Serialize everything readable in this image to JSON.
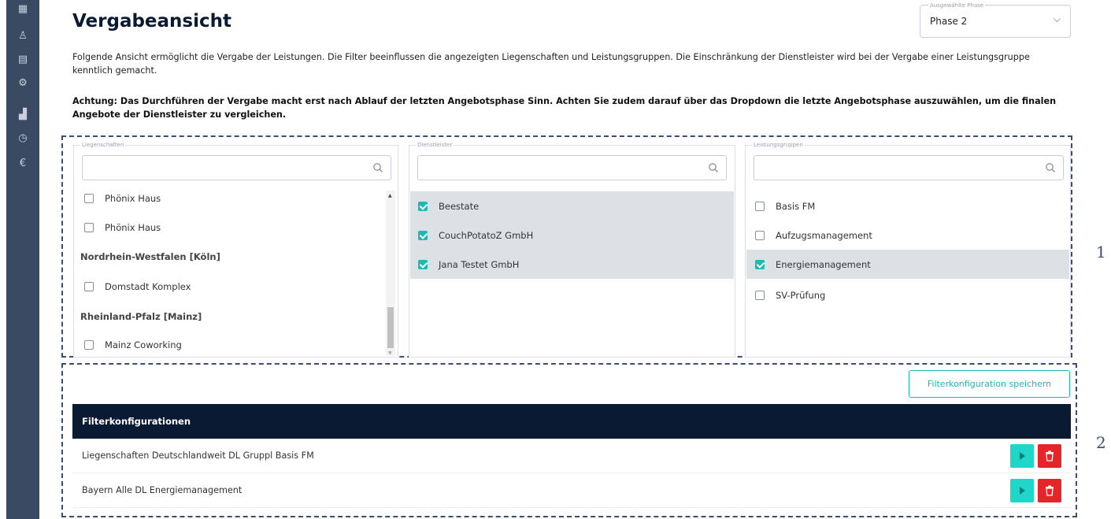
{
  "page_title": "Vergabeansicht",
  "phase_select": {
    "label": "Ausgewählte Phase",
    "value": "Phase 2"
  },
  "description": "Folgende Ansicht ermöglicht die Vergabe der Leistungen. Die Filter beeinflussen die angezeigten Liegenschaften und Leistungsgruppen. Die Einschränkung der Dienstleister wird bei der Vergabe einer Leistungsgruppe kenntlich gemacht.",
  "warning": "Achtung: Das Durchführen der Vergabe macht erst nach Ablauf der letzten Angebotsphase Sinn. Achten Sie zudem darauf über das Dropdown die letzte Angebotsphase auszuwählen, um die finalen Angebote der Dienstleister zu vergleichen.",
  "liegenschaften": {
    "label": "Liegenschaften",
    "items": [
      {
        "type": "item",
        "label": "Phönix Haus",
        "checked": false
      },
      {
        "type": "item",
        "label": "Phönix Haus",
        "checked": false
      },
      {
        "type": "group",
        "label": "Nordrhein-Westfalen [Köln]"
      },
      {
        "type": "item",
        "label": "Domstadt Komplex",
        "checked": false
      },
      {
        "type": "group",
        "label": "Rheinland-Pfalz [Mainz]"
      },
      {
        "type": "item",
        "label": "Mainz Coworking",
        "checked": false
      }
    ]
  },
  "dienstleister": {
    "label": "Dienstleister",
    "items": [
      {
        "label": "Beestate",
        "checked": true
      },
      {
        "label": "CouchPotatoZ GmbH",
        "checked": true
      },
      {
        "label": "Jana Testet GmbH",
        "checked": true
      }
    ]
  },
  "leistungsgruppen": {
    "label": "Leistungsgruppen",
    "items": [
      {
        "label": "Basis FM",
        "checked": false
      },
      {
        "label": "Aufzugsmanagement",
        "checked": false
      },
      {
        "label": "Energiemanagement",
        "checked": true
      },
      {
        "label": "SV-Prüfung",
        "checked": false
      }
    ]
  },
  "save_button": "Filterkonfiguration speichern",
  "table": {
    "header": "Filterkonfigurationen",
    "rows": [
      {
        "name": "Liegenschaften Deutschlandweit DL Gruppl Basis FM"
      },
      {
        "name": "Bayern Alle DL Energiemanagement"
      }
    ]
  },
  "annotations": {
    "a1": "1",
    "a2": "2"
  },
  "sidebar_icons": [
    "dashboard-icon",
    "user-icon",
    "map-icon",
    "settings-icon",
    "chart-icon",
    "history-icon",
    "euro-icon"
  ],
  "colors": {
    "accent": "#1fb8b3",
    "danger": "#e5252a",
    "navy": "#0b1a33",
    "sidebar": "#3b4a63",
    "dash": "#3a4d78"
  }
}
